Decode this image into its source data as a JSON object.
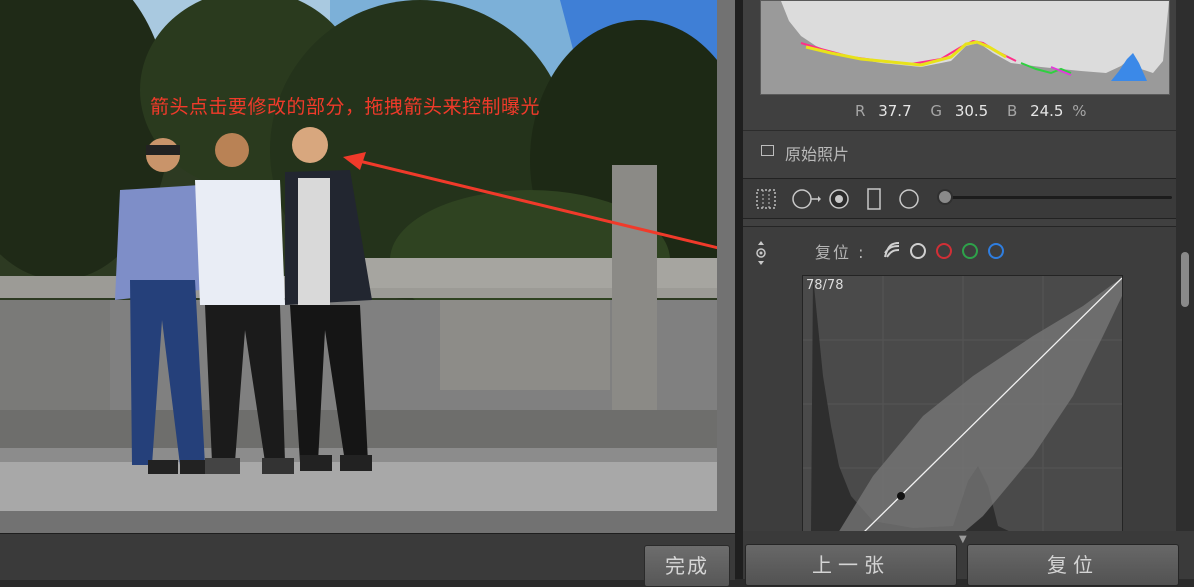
{
  "annotation": {
    "text": "箭头点击要修改的部分，拖拽箭头来控制曝光",
    "color": "#f03a2a"
  },
  "readout": {
    "r_label": "R",
    "r_value": "37.7",
    "g_label": "G",
    "g_value": "30.5",
    "b_label": "B",
    "b_value": "24.5",
    "unit": "%"
  },
  "original_photo": {
    "label": "原始照片",
    "checked": false
  },
  "curve": {
    "reset_label": "复位 :",
    "readout": "78/78",
    "channels": [
      "luminosity-icon",
      "rgb",
      "red",
      "green",
      "blue"
    ]
  },
  "buttons": {
    "done": "完成",
    "prev": "上一张",
    "reset": "复位"
  },
  "colors": {
    "accent_red": "#f03a2a",
    "channel_red": "#d12f36",
    "channel_green": "#2ea24a",
    "channel_blue": "#2f7ee0"
  },
  "tools": [
    "crop-grid-icon",
    "spot-removal-icon",
    "red-eye-icon",
    "graduated-filter-icon",
    "radial-filter-icon",
    "brush-slider"
  ]
}
